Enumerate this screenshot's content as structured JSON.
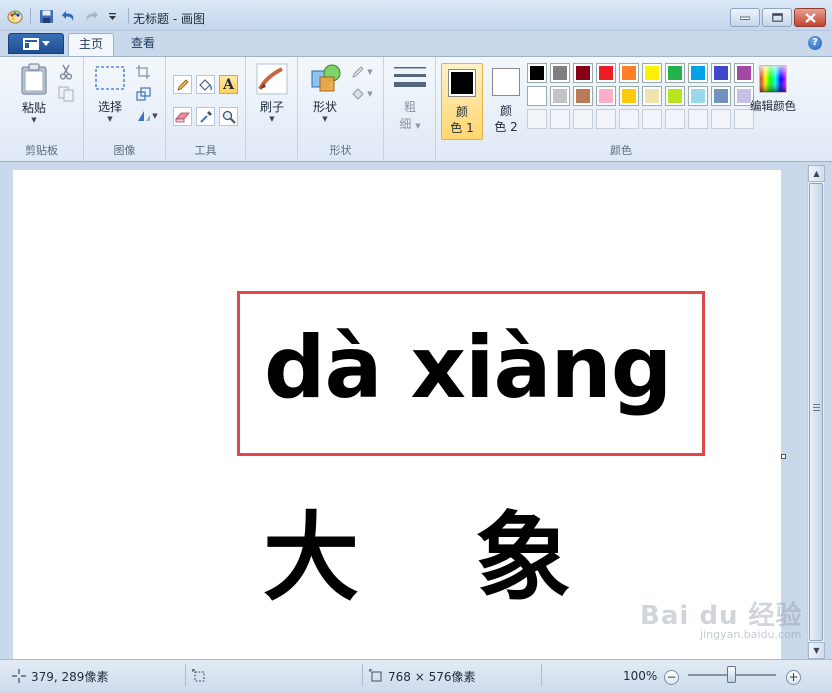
{
  "window": {
    "title": "无标题 - 画图",
    "controls": {
      "minimize": "minimize",
      "maximize": "maximize",
      "close": "close"
    }
  },
  "tabs": [
    {
      "label": "主页",
      "active": true
    },
    {
      "label": "查看",
      "active": false
    }
  ],
  "help_label": "?",
  "ribbon": {
    "groups": {
      "clipboard": {
        "label": "剪贴板",
        "paste": "粘贴"
      },
      "image": {
        "label": "图像",
        "select": "选择"
      },
      "tools": {
        "label": "工具",
        "text_glyph": "A"
      },
      "brushes": {
        "label": "刷子"
      },
      "shapes": {
        "label": "形状",
        "shapes": "形状"
      },
      "size": {
        "label_line1": "粗",
        "label_line2": "细"
      },
      "colors": {
        "label": "颜色",
        "color1_line1": "颜",
        "color1_line2": "色 1",
        "color2_line1": "颜",
        "color2_line2": "色 2",
        "edit_colors": "编辑颜色",
        "color1_value": "#000000",
        "color2_value": "#ffffff"
      }
    },
    "palette": [
      [
        "#000000",
        "#7f7f7f",
        "#880015",
        "#ed1c24",
        "#ff7f27",
        "#fff200",
        "#22b14c",
        "#00a2e8",
        "#3f48cc",
        "#a349a4"
      ],
      [
        "#ffffff",
        "#c3c3c3",
        "#b97a57",
        "#ffaec9",
        "#ffc90e",
        "#efe4b0",
        "#b5e61d",
        "#99d9ea",
        "#7092be",
        "#c8bfe7"
      ],
      [
        "",
        "",
        "",
        "",
        "",
        "",
        "",
        "",
        "",
        ""
      ]
    ]
  },
  "canvas": {
    "pinyin": "dà xiàng",
    "hanzi_1": "大",
    "hanzi_2": "象",
    "box_color": "#e0464a"
  },
  "statusbar": {
    "cursor_position": "379, 289像素",
    "image_size": "768 × 576像素",
    "zoom": "100%",
    "zoom_minus": "−",
    "zoom_plus": "+"
  },
  "watermark": {
    "brand": "Bai du 经验",
    "sub": "jingyan.baidu.com"
  }
}
